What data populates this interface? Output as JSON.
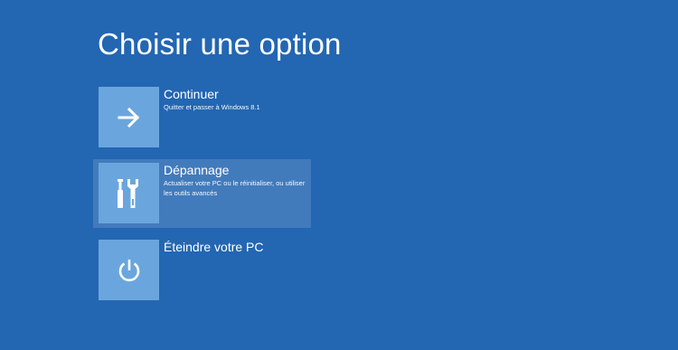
{
  "screen": {
    "title": "Choisir une option",
    "background_color": "#2366b2",
    "tile_color": "#6aa6dd"
  },
  "options": [
    {
      "label": "Continuer",
      "description": "Quitter et passer à Windows 8.1",
      "icon": "arrow-right-icon",
      "selected": false
    },
    {
      "label": "Dépannage",
      "description": "Actualiser votre PC ou le réinitialiser, ou utiliser les outils avancés",
      "icon": "tools-icon",
      "selected": true
    },
    {
      "label": "Éteindre votre PC",
      "description": "",
      "icon": "power-icon",
      "selected": false
    }
  ]
}
